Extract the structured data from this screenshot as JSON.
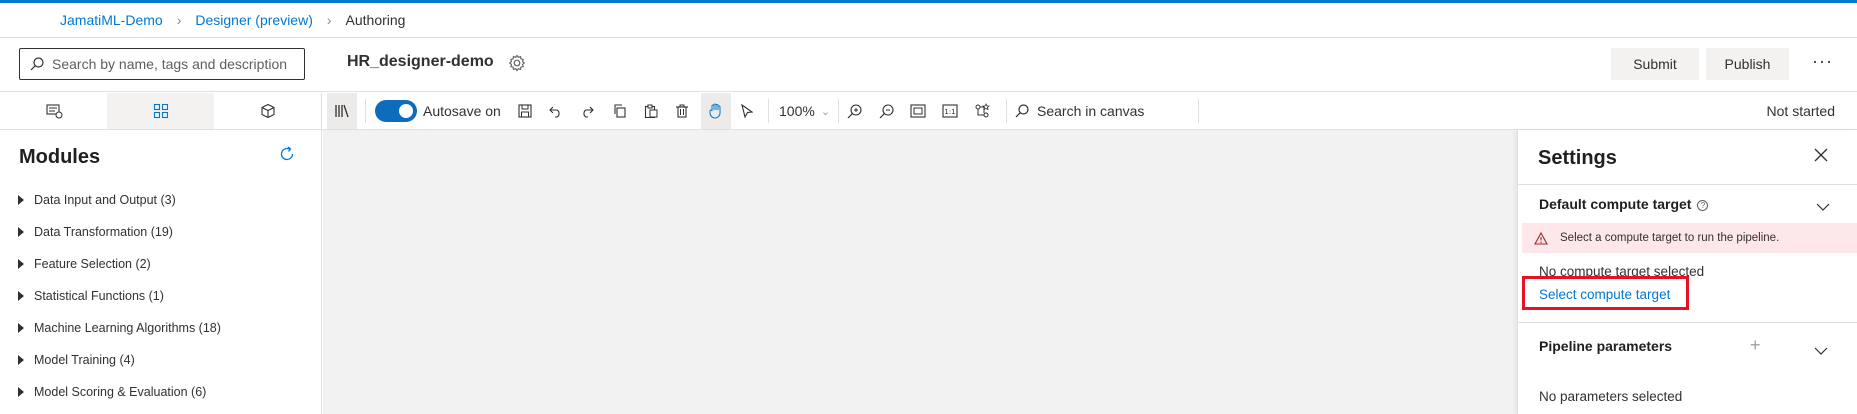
{
  "breadcrumb": {
    "workspace": "JamatiML-Demo",
    "designer": "Designer (preview)",
    "current": "Authoring"
  },
  "header": {
    "search_placeholder": "Search by name, tags and description",
    "pipeline_name": "HR_designer-demo",
    "submit_label": "Submit",
    "publish_label": "Publish",
    "more_label": "···"
  },
  "toolbar": {
    "autosave_label": "Autosave on",
    "autosave_on": true,
    "zoom": "100%",
    "search_canvas": "Search in canvas",
    "status": "Not started"
  },
  "modules": {
    "title": "Modules",
    "items": [
      {
        "label": "Data Input and Output (3)"
      },
      {
        "label": "Data Transformation (19)"
      },
      {
        "label": "Feature Selection (2)"
      },
      {
        "label": "Statistical Functions (1)"
      },
      {
        "label": "Machine Learning Algorithms (18)"
      },
      {
        "label": "Model Training (4)"
      },
      {
        "label": "Model Scoring & Evaluation (6)"
      }
    ]
  },
  "settings": {
    "title": "Settings",
    "compute_section_title": "Default compute target",
    "warning_text": "Select a compute target to run the pipeline.",
    "no_compute_text": "No compute target selected",
    "select_compute_link": "Select compute target",
    "params_section_title": "Pipeline parameters",
    "no_params_text": "No parameters selected"
  },
  "colors": {
    "accent": "#0078d4",
    "warning_bg": "#fde7e9",
    "highlight": "#e81123",
    "canvas_bg": "#f2f2f2"
  }
}
